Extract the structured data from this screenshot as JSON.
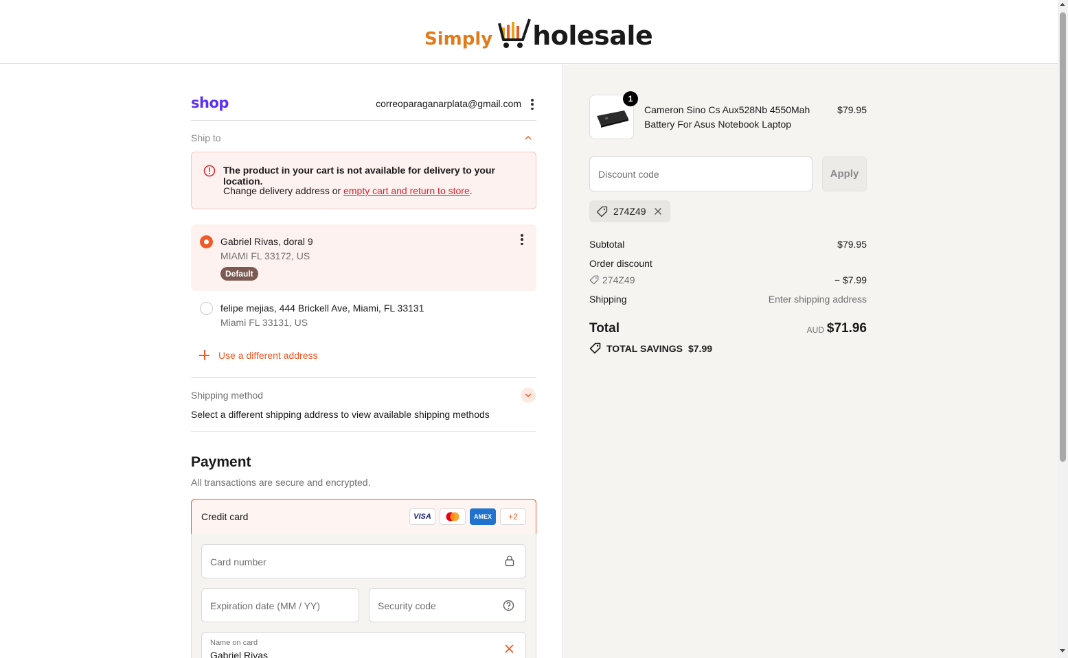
{
  "brand": {
    "logo_simply": "Simply",
    "logo_holesale": "holesale"
  },
  "account": {
    "shop_label": "shop",
    "email": "correoparaganarplata@gmail.com"
  },
  "ship_to": {
    "label": "Ship to",
    "alert": {
      "title": "The product in your cart is not available for delivery to your location.",
      "body_prefix": "Change delivery address or ",
      "link": "empty cart and return to store",
      "body_suffix": "."
    },
    "addresses": [
      {
        "line1": "Gabriel Rivas, doral 9",
        "line2": "MIAMI FL 33172, US",
        "badge": "Default",
        "selected": true
      },
      {
        "line1": "felipe mejias, 444 Brickell Ave, Miami, FL 33131",
        "line2": "Miami FL 33131, US",
        "selected": false
      }
    ],
    "add_address": "Use a different address"
  },
  "shipping_method": {
    "label": "Shipping method",
    "note": "Select a different shipping address to view available shipping methods"
  },
  "payment": {
    "title": "Payment",
    "subtitle": "All transactions are secure and encrypted.",
    "method_label": "Credit card",
    "card_brands": [
      "VISA",
      "mastercard",
      "AMEX",
      "+2"
    ],
    "card_number_placeholder": "Card number",
    "expiration_placeholder": "Expiration date (MM / YY)",
    "security_placeholder": "Security code",
    "name_label": "Name on card",
    "name_value": "Gabriel Rivas"
  },
  "order": {
    "item": {
      "quantity": "1",
      "name": "Cameron Sino Cs Aux528Nb 4550Mah Battery For Asus Notebook Laptop",
      "price": "$79.95"
    },
    "discount_placeholder": "Discount code",
    "apply_label": "Apply",
    "applied_code": "274Z49",
    "subtotal_label": "Subtotal",
    "subtotal_value": "$79.95",
    "order_discount_label": "Order discount",
    "order_discount_code": "274Z49",
    "order_discount_value": "− $7.99",
    "shipping_label": "Shipping",
    "shipping_value": "Enter shipping address",
    "total_label": "Total",
    "total_currency": "AUD",
    "total_value": "$71.96",
    "savings_label": "TOTAL SAVINGS",
    "savings_value": "$7.99"
  },
  "colors": {
    "accent": "#f05a28",
    "shop_purple": "#5a31f4",
    "error_red": "#d8212f",
    "summary_bg": "#f6f4f1"
  }
}
